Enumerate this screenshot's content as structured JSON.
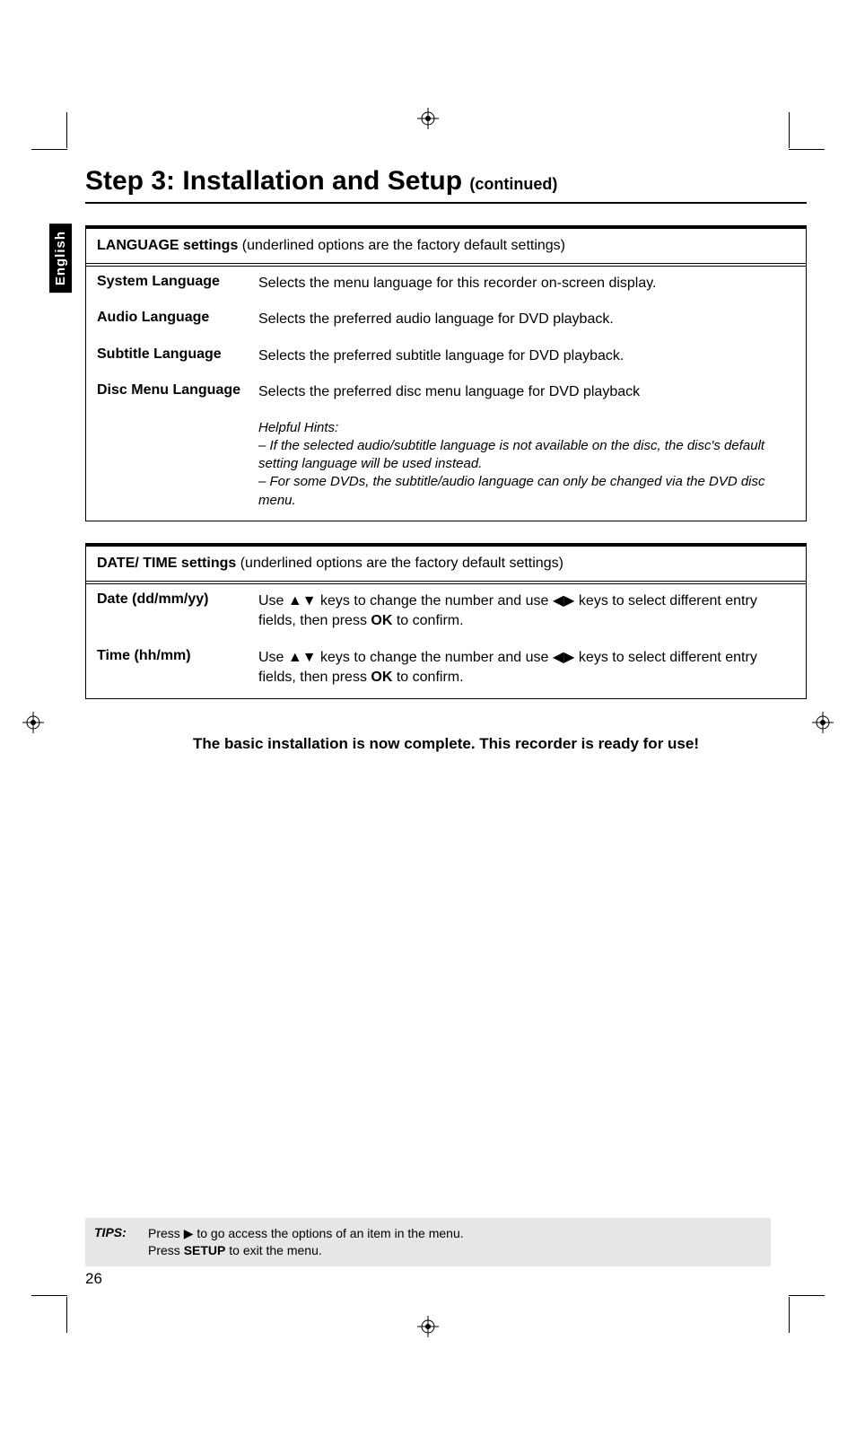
{
  "heading": {
    "main": "Step 3: Installation and Setup",
    "continued": "(continued)"
  },
  "langTab": "English",
  "tables": [
    {
      "title": "LANGUAGE settings",
      "note": "(underlined options are the factory default settings)",
      "rows": [
        {
          "label": "System Language",
          "desc": "Selects the menu language for this recorder on-screen display."
        },
        {
          "label": "Audio Language",
          "desc": "Selects the preferred audio language for DVD playback."
        },
        {
          "label": "Subtitle Language",
          "desc": "Selects the preferred subtitle language for DVD playback."
        },
        {
          "label": "Disc Menu Language",
          "desc": "Selects the preferred disc menu language for DVD playback"
        }
      ],
      "hints": {
        "title": "Helpful Hints:",
        "lines": [
          "– If the selected audio/subtitle language is not available on the disc, the disc's default setting language will be used instead.",
          "– For some DVDs, the subtitle/audio language can only be changed via the DVD disc menu."
        ]
      }
    },
    {
      "title": "DATE/ TIME settings",
      "note": "(underlined options are the factory default settings)",
      "rows": [
        {
          "label": "Date (dd/mm/yy)",
          "desc_pre": "Use ",
          "arrows1": "▲▼",
          "desc_mid": " keys to change the number and use ",
          "arrows2": "◀▶",
          "desc_post": " keys to select different entry fields, then press ",
          "ok": "OK",
          "desc_end": " to confirm."
        },
        {
          "label": "Time (hh/mm)",
          "desc_pre": "Use ",
          "arrows1": "▲▼",
          "desc_mid": " keys to change the number and use ",
          "arrows2": "◀▶",
          "desc_post": " keys to select different entry fields, then press ",
          "ok": "OK",
          "desc_end": " to confirm."
        }
      ]
    }
  ],
  "completeMsg": "The basic installation is now complete. This recorder is ready for use!",
  "tips": {
    "label": "TIPS:",
    "line1_pre": "Press ",
    "line1_arrow": "▶",
    "line1_post": " to go access the options of an item in the menu.",
    "line2_pre": "Press ",
    "line2_bold": "SETUP",
    "line2_post": " to exit the menu."
  },
  "pageNum": "26"
}
